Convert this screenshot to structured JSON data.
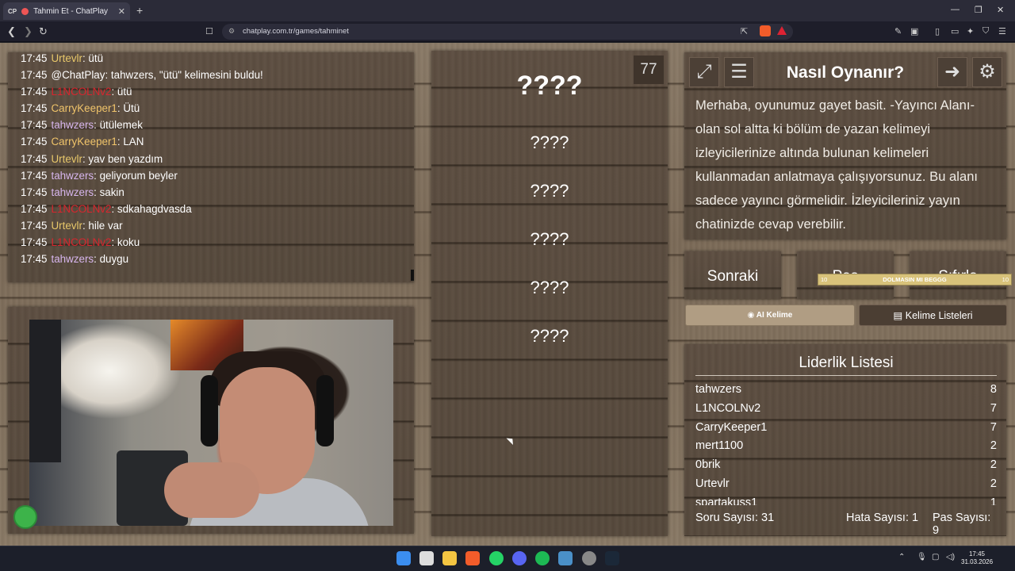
{
  "browser": {
    "tab_favicon_text": "CP",
    "tab_title": "Tahmin Et - ChatPlay",
    "url": "chatplay.com.tr/games/tahminet"
  },
  "chat": {
    "messages": [
      {
        "time": "17:45",
        "user": "Urtevlr",
        "sep": ": ",
        "text": "ütü",
        "color": "#e8c86a"
      },
      {
        "time": "17:45",
        "user": "@ChatPlay",
        "sep": ": ",
        "text": "tahwzers, \"ütü\" kelimesini buldu!",
        "color": "#ffffff"
      },
      {
        "time": "17:45",
        "user": "L1NCOLNv2",
        "sep": ": ",
        "text": "ütü",
        "color": "#d8262e"
      },
      {
        "time": "17:45",
        "user": "CarryKeeper1",
        "sep": ": ",
        "text": "Ütü",
        "color": "#f0c46a"
      },
      {
        "time": "17:45",
        "user": "tahwzers",
        "sep": ": ",
        "text": "ütülemek",
        "color": "#d7b6ee"
      },
      {
        "time": "17:45",
        "user": "CarryKeeper1",
        "sep": ": ",
        "text": "LAN",
        "color": "#f0c46a"
      },
      {
        "time": "17:45",
        "user": "Urtevlr",
        "sep": ": ",
        "text": "yav ben yazdım",
        "color": "#e8c86a"
      },
      {
        "time": "17:45",
        "user": "tahwzers",
        "sep": ": ",
        "text": "geliyorum beyler",
        "color": "#d7b6ee"
      },
      {
        "time": "17:45",
        "user": "tahwzers",
        "sep": ": ",
        "text": "sakin",
        "color": "#d7b6ee"
      },
      {
        "time": "17:45",
        "user": "L1NCOLNv2",
        "sep": ": ",
        "text": "sdkahagdvasda",
        "color": "#d8262e"
      },
      {
        "time": "17:45",
        "user": "Urtevlr",
        "sep": ": ",
        "text": "hile var",
        "color": "#e8c86a"
      },
      {
        "time": "17:45",
        "user": "L1NCOLNv2",
        "sep": ": ",
        "text": "koku",
        "color": "#d8262e"
      },
      {
        "time": "17:45",
        "user": "tahwzers",
        "sep": ": ",
        "text": "duygu",
        "color": "#d7b6ee"
      }
    ]
  },
  "words": {
    "first": "????",
    "rest": [
      "????",
      "????",
      "????",
      "????",
      "????"
    ],
    "count": "77"
  },
  "howto": {
    "title": "Nasıl Oynanır?",
    "text": "Merhaba, oyunumuz gayet basit. -Yayıncı Alanı- olan sol altta ki bölüm de yazan kelimeyi izleyicilerinize altında bulunan kelimeleri kullanmadan anlatmaya çalışıyorsunuz. Bu alanı sadece yayıncı görmelidir. İzleyicileriniz yayın chatinizde cevap verebilir."
  },
  "actions": {
    "next": "Sonraki",
    "pass": "Pas",
    "reset": "Sıfırla",
    "strip_left": "10",
    "strip_center": "DOLMASIN MI BEGGG",
    "strip_right": "10",
    "ai_word": "AI Kelime",
    "word_lists": "Kelime Listeleri"
  },
  "leaderboard": {
    "title": "Liderlik Listesi",
    "rows": [
      {
        "name": "tahwzers",
        "score": "8"
      },
      {
        "name": "L1NCOLNv2",
        "score": "7"
      },
      {
        "name": "CarryKeeper1",
        "score": "7"
      },
      {
        "name": "mert1100",
        "score": "2"
      },
      {
        "name": "0brik",
        "score": "2"
      },
      {
        "name": "Urtevlr",
        "score": "2"
      },
      {
        "name": "spartakuss1",
        "score": "1"
      }
    ]
  },
  "stats": {
    "questions": "Soru Sayısı: 31",
    "errors": "Hata Sayısı: 1",
    "passes": "Pas Sayısı: 9"
  },
  "taskbar": {
    "time": "17:45",
    "date": "31.03.2026"
  }
}
